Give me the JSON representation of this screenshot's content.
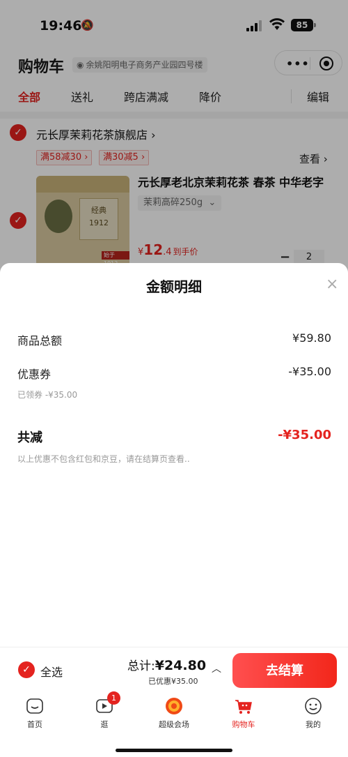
{
  "status_bar": {
    "time": "19:46",
    "battery": "85"
  },
  "header": {
    "title": "购物车",
    "address": "余姚阳明电子商务产业园四号楼"
  },
  "tabs": [
    "全部",
    "送礼",
    "跨店满减",
    "降价"
  ],
  "edit_label": "编辑",
  "shop": {
    "name": "元长厚茉莉花茶旗舰店 ›"
  },
  "promos": [
    "满58减30 ›",
    "满30减5 ›"
  ],
  "view_label": "查看 ›",
  "product": {
    "title": "元长厚老北京茉莉花茶 春茶 中华老字",
    "spec": "茉莉高碎250g",
    "package_text": "经典\n1912",
    "package_badge": "始于1912",
    "price_symbol": "¥",
    "price_int": "12",
    "price_dec": ".4",
    "price_tag": "到手价",
    "qty_minus": "−",
    "quantity": "2"
  },
  "sheet": {
    "title": "金额明细",
    "close": "×",
    "items_label": "商品总额",
    "items_value": "¥59.80",
    "coupon_label": "优惠券",
    "coupon_value": "-¥35.00",
    "coupon_sub": "已领券 -¥35.00",
    "total_label": "共减",
    "total_value": "-¥35.00",
    "note": "以上优惠不包含红包和京豆，请在结算页查看.."
  },
  "checkout": {
    "select_all": "全选",
    "sum_label": "总计:",
    "sum_value": "¥24.80",
    "saved": "已优惠¥35.00",
    "button": "去结算"
  },
  "tabbar": {
    "items": [
      {
        "label": "首页",
        "icon": "home-icon"
      },
      {
        "label": "逛",
        "icon": "video-icon",
        "badge": "1"
      },
      {
        "label": "超级会场",
        "icon": "super-venue-icon"
      },
      {
        "label": "购物车",
        "icon": "cart-icon"
      },
      {
        "label": "我的",
        "icon": "profile-icon"
      }
    ]
  },
  "colors": {
    "accent": "#e4231f",
    "muted_text": "#999999"
  }
}
